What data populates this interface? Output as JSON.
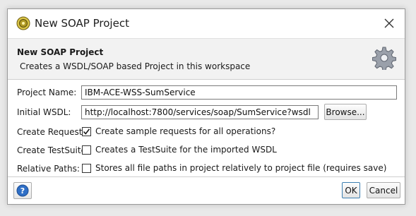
{
  "window": {
    "title": "New SOAP Project"
  },
  "banner": {
    "title": "New SOAP Project",
    "description": "Creates a WSDL/SOAP based Project in this workspace"
  },
  "form": {
    "project_name": {
      "label": "Project Name:",
      "value": "IBM-ACE-WSS-SumService"
    },
    "initial_wsdl": {
      "label": "Initial WSDL:",
      "value": "http://localhost:7800/services/soap/SumService?wsdl",
      "browse_label": "Browse..."
    },
    "create_requests": {
      "label": "Create Requests:",
      "checkbox_text": "Create sample requests for all operations?",
      "checked": true
    },
    "create_testsuite": {
      "label": "Create TestSuite:",
      "checkbox_text": "Creates a TestSuite for the imported WSDL",
      "checked": false
    },
    "relative_paths": {
      "label": "Relative Paths:",
      "checkbox_text": "Stores all file paths in project relatively to project file (requires save)",
      "checked": false
    }
  },
  "footer": {
    "ok_label": "OK",
    "cancel_label": "Cancel"
  },
  "icons": {
    "app": "soapui-app-icon",
    "close": "close-icon",
    "banner": "gear-icon",
    "help": "help-icon",
    "check": "checkmark-icon"
  },
  "colors": {
    "banner_bg": "#f2f2f2",
    "help_blue": "#2f6fc6",
    "gear_gray": "#8a8f99",
    "app_icon_yellow": "#c9b13a"
  }
}
